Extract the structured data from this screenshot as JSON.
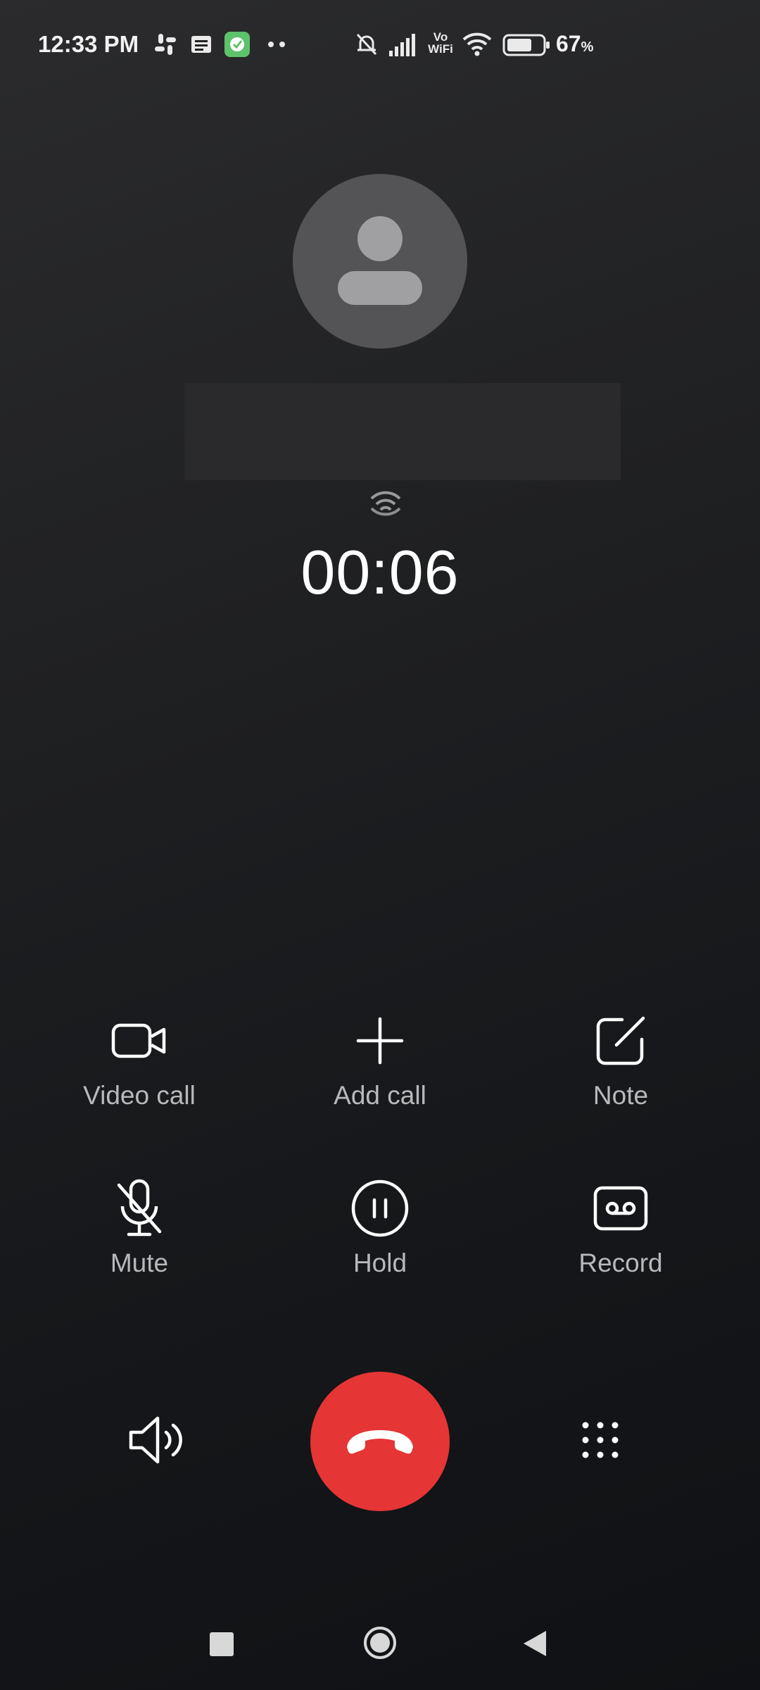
{
  "status_bar": {
    "time": "12:33 PM",
    "battery_percent": "67",
    "battery_percent_sign": "%",
    "vo_label": "Vo",
    "wifi_label": "WiFi",
    "icons": [
      "slack-icon",
      "news-icon",
      "app-badge-icon",
      "more-dots-icon",
      "silent-bell-icon",
      "signal-icon",
      "vowifi-icon",
      "wifi-icon",
      "battery-icon"
    ]
  },
  "call": {
    "timer": "00:06"
  },
  "actions": [
    {
      "label": "Video call",
      "icon": "video-camera-icon"
    },
    {
      "label": "Add call",
      "icon": "plus-icon"
    },
    {
      "label": "Note",
      "icon": "note-edit-icon"
    },
    {
      "label": "Mute",
      "icon": "mic-off-icon"
    },
    {
      "label": "Hold",
      "icon": "pause-icon"
    },
    {
      "label": "Record",
      "icon": "record-tape-icon"
    }
  ],
  "controls": {
    "speaker_icon": "speaker-icon",
    "end_call_icon": "hang-up-icon",
    "keypad_icon": "keypad-icon"
  },
  "colors": {
    "end_call": "#e53535",
    "label": "#b9b9bb",
    "background": "#1e1f21",
    "avatar": "#545456"
  }
}
